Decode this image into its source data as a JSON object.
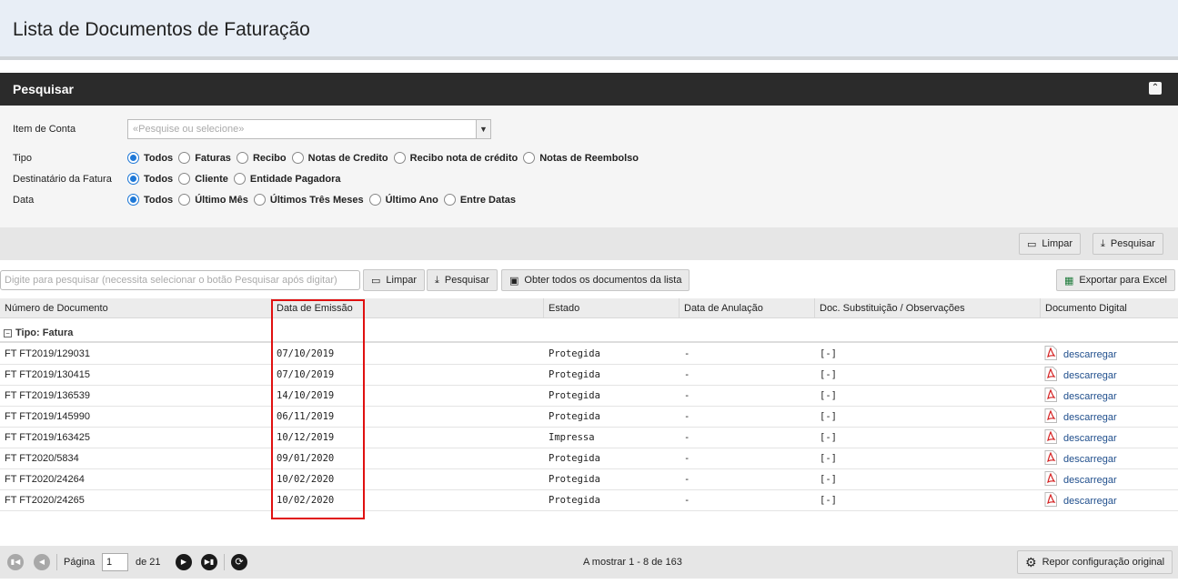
{
  "page": {
    "title": "Lista de Documentos de Faturação"
  },
  "search_panel": {
    "title": "Pesquisar",
    "item_conta": {
      "label": "Item de Conta",
      "placeholder": "«Pesquise ou selecione»"
    },
    "tipo": {
      "label": "Tipo",
      "options": [
        "Todos",
        "Faturas",
        "Recibo",
        "Notas de Credito",
        "Recibo nota de crédito",
        "Notas de Reembolso"
      ],
      "selected": 0
    },
    "destinatario": {
      "label": "Destinatário da Fatura",
      "options": [
        "Todos",
        "Cliente",
        "Entidade Pagadora"
      ],
      "selected": 0
    },
    "data": {
      "label": "Data",
      "options": [
        "Todos",
        "Último Mês",
        "Últimos Três Meses",
        "Último Ano",
        "Entre Datas"
      ],
      "selected": 0
    },
    "clear_label": "Limpar",
    "search_label": "Pesquisar"
  },
  "grid_toolbar": {
    "search_placeholder": "Digite para pesquisar (necessita selecionar o botão Pesquisar após digitar)",
    "clear_label": "Limpar",
    "search_label": "Pesquisar",
    "get_all_label": "Obter todos os documentos da lista",
    "export_label": "Exportar para Excel"
  },
  "grid": {
    "columns": [
      "Número de Documento",
      "Data de Emissão",
      "Estado",
      "Data de Anulação",
      "Doc. Substituição / Observações",
      "Documento Digital"
    ],
    "group_label": "Tipo: Fatura",
    "download_label": "descarregar",
    "rows": [
      {
        "numero": "FT FT2019/129031",
        "data": "07/10/2019",
        "estado": "Protegida",
        "anulacao": "-",
        "obs": "[-]"
      },
      {
        "numero": "FT FT2019/130415",
        "data": "07/10/2019",
        "estado": "Protegida",
        "anulacao": "-",
        "obs": "[-]"
      },
      {
        "numero": "FT FT2019/136539",
        "data": "14/10/2019",
        "estado": "Protegida",
        "anulacao": "-",
        "obs": "[-]"
      },
      {
        "numero": "FT FT2019/145990",
        "data": "06/11/2019",
        "estado": "Protegida",
        "anulacao": "-",
        "obs": "[-]"
      },
      {
        "numero": "FT FT2019/163425",
        "data": "10/12/2019",
        "estado": "Impressa",
        "anulacao": "-",
        "obs": "[-]"
      },
      {
        "numero": "FT FT2020/5834",
        "data": "09/01/2020",
        "estado": "Protegida",
        "anulacao": "-",
        "obs": "[-]"
      },
      {
        "numero": "FT FT2020/24264",
        "data": "10/02/2020",
        "estado": "Protegida",
        "anulacao": "-",
        "obs": "[-]"
      },
      {
        "numero": "FT FT2020/24265",
        "data": "10/02/2020",
        "estado": "Protegida",
        "anulacao": "-",
        "obs": "[-]"
      }
    ]
  },
  "footer": {
    "page_label": "Página",
    "current_page": "1",
    "total_label": "de 21",
    "showing_label": "A mostrar 1 - 8 de 163",
    "reset_label": "Repor configuração original"
  },
  "colors": {
    "highlight": "#e01010",
    "radio_accent": "#1e78d7",
    "panel_bar": "#2b2b2b",
    "link": "#1f4e8c",
    "pdf_red": "#d42020"
  }
}
